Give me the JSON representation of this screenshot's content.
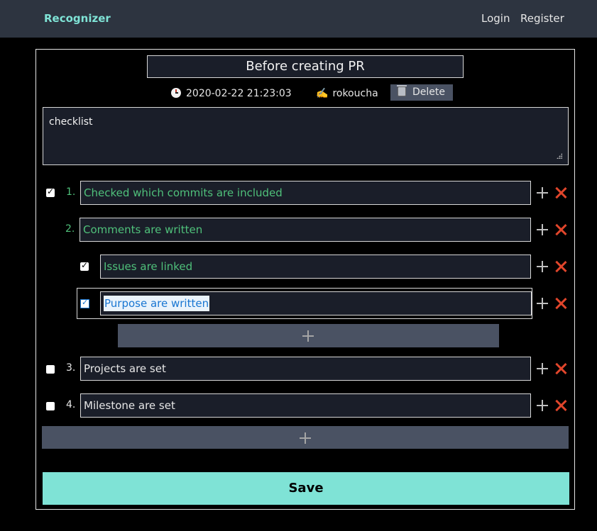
{
  "navbar": {
    "brand": "Recognizer",
    "login": "Login",
    "register": "Register"
  },
  "checklist": {
    "title": "Before creating PR",
    "timestamp": "2020-02-22 21:23:03",
    "author": "rokoucha",
    "author_icon": "✍️",
    "delete_label": "Delete",
    "description": "checklist",
    "items": [
      {
        "number": "1.",
        "text": "Checked which commits are included",
        "checked": true
      },
      {
        "number": "2.",
        "text": "Comments are written",
        "checked": false,
        "children": [
          {
            "text": "Issues are linked",
            "checked": true
          },
          {
            "text": "Purpose are written",
            "checked": true,
            "focused": true
          }
        ]
      },
      {
        "number": "3.",
        "text": "Projects are set",
        "checked": false
      },
      {
        "number": "4.",
        "text": "Milestone are set",
        "checked": false
      }
    ],
    "save_label": "Save"
  },
  "colors": {
    "accent": "#7fe3d6",
    "done": "#4fc07a",
    "delete": "#e0452b",
    "navbar": "#2d3440",
    "input_bg": "#1a1e29"
  }
}
